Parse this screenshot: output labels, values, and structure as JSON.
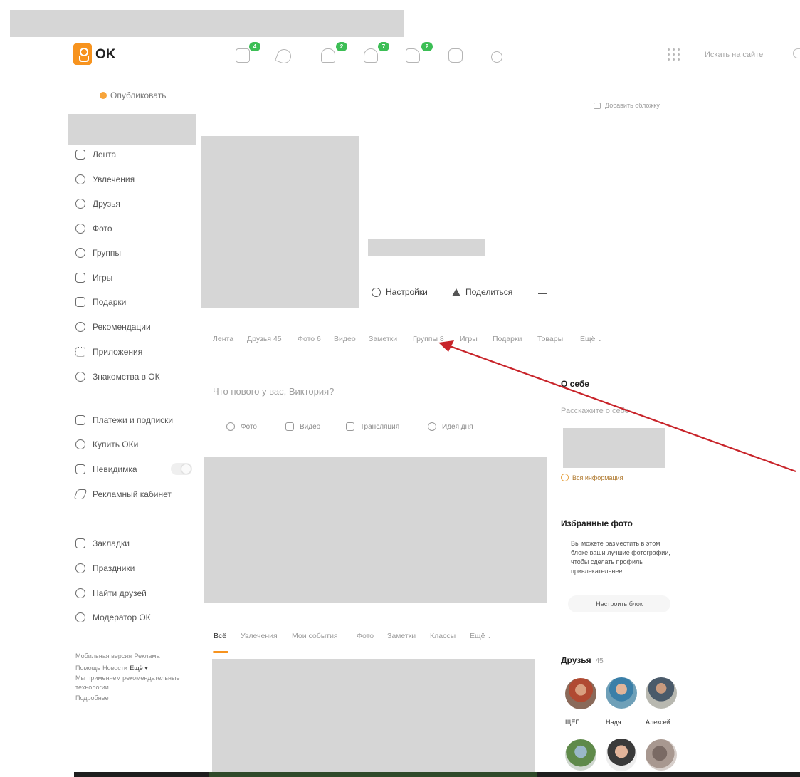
{
  "header": {
    "logo_text": "OK",
    "badges": [
      "4",
      "2",
      "7",
      "2"
    ],
    "search_placeholder": "Искать на сайте"
  },
  "sidebar": {
    "publish_label": "Опубликовать",
    "nav": [
      {
        "label": "Лента",
        "icon": "home-icon"
      },
      {
        "label": "Увлечения",
        "icon": "hobby-icon"
      },
      {
        "label": "Друзья",
        "icon": "friends-icon"
      },
      {
        "label": "Фото",
        "icon": "photo-icon"
      },
      {
        "label": "Группы",
        "icon": "groups-icon"
      },
      {
        "label": "Игры",
        "icon": "games-icon"
      },
      {
        "label": "Подарки",
        "icon": "gift-icon"
      },
      {
        "label": "Рекомендации",
        "icon": "recommendations-icon"
      },
      {
        "label": "Приложения",
        "icon": "apps-icon"
      },
      {
        "label": "Знакомства в ОК",
        "icon": "dating-icon"
      }
    ],
    "services": [
      {
        "label": "Платежи и подписки",
        "icon": "payments-icon"
      },
      {
        "label": "Купить ОКи",
        "icon": "coin-icon"
      },
      {
        "label": "Невидимка",
        "icon": "invisible-icon"
      },
      {
        "label": "Рекламный кабинет",
        "icon": "ads-icon"
      }
    ],
    "extras": [
      {
        "label": "Закладки",
        "icon": "bookmark-icon"
      },
      {
        "label": "Праздники",
        "icon": "holiday-icon"
      },
      {
        "label": "Найти друзей",
        "icon": "find-friends-icon"
      },
      {
        "label": "Модератор ОК",
        "icon": "moderator-icon"
      }
    ],
    "footer": {
      "mobile": "Мобильная версия",
      "ads": "Реклама",
      "help": "Помощь",
      "news": "Новости",
      "more": "Ещё ▾",
      "cookies": "Мы применяем рекомендательные технологии",
      "details": "Подробнее"
    }
  },
  "profile": {
    "settings_label": "Настройки",
    "share_label": "Поделиться",
    "tabs": [
      "Лента",
      "Друзья 45",
      "Фото 6",
      "Видео",
      "Заметки",
      "Группы 8",
      "Игры",
      "Подарки",
      "Товары",
      "Ещё"
    ],
    "whats_new": "Что нового у вас, Виктория?",
    "post_buttons": [
      "Фото",
      "Видео",
      "Трансляция",
      "Идея дня"
    ],
    "feed_tabs": [
      "Всё",
      "Увлечения",
      "Мои события",
      "Фото",
      "Заметки",
      "Классы",
      "Ещё"
    ]
  },
  "right": {
    "add_cover": "Добавить обложку",
    "about_title": "О себе",
    "about_placeholder": "Расскажите о себе",
    "all_info": "Вся информация",
    "fav_title": "Избранные фото",
    "fav_text": "Вы можете разместить в этом блоке ваши лучшие фотографии, чтобы сделать профиль привлекательнее",
    "fav_button": "Настроить блок",
    "friends_title": "Друзья",
    "friends_count": "45",
    "friends": [
      {
        "name": "ЩЕГ…"
      },
      {
        "name": "Надя…"
      },
      {
        "name": "Алексей"
      }
    ]
  },
  "colors": {
    "brand": "#f7931e",
    "badge": "#3cbe55",
    "arrow": "#c8242a",
    "redacted": "#d6d6d6"
  }
}
